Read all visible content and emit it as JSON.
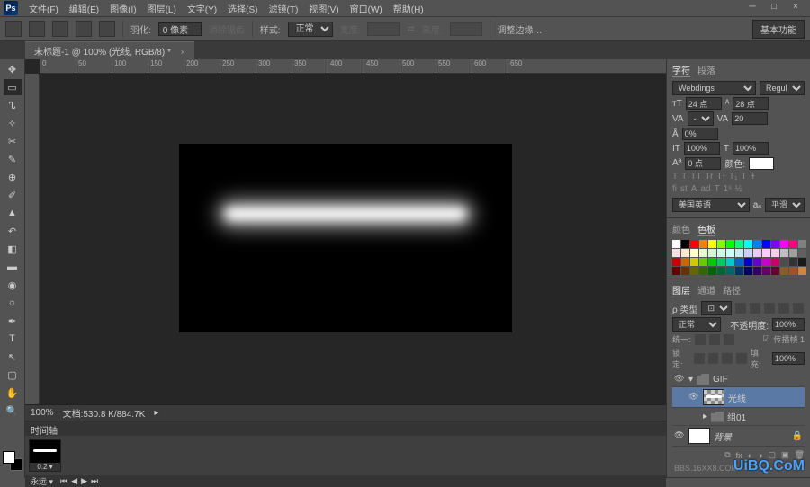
{
  "menu": {
    "items": [
      "文件(F)",
      "编辑(E)",
      "图像(I)",
      "图层(L)",
      "文字(Y)",
      "选择(S)",
      "滤镜(T)",
      "视图(V)",
      "窗口(W)",
      "帮助(H)"
    ]
  },
  "optbar": {
    "feather_label": "羽化:",
    "feather_value": "0 像素",
    "antialias": "消除锯齿",
    "style_label": "样式:",
    "style_value": "正常",
    "width_label": "宽度:",
    "height_label": "高度:",
    "refine": "调整边缘…",
    "workspace_pill": "基本功能"
  },
  "doctab": {
    "title": "未标题-1 @ 100% (光线, RGB/8) *"
  },
  "ruler_ticks": [
    "0",
    "50",
    "100",
    "150",
    "200",
    "250",
    "300",
    "350",
    "400",
    "450",
    "500",
    "550",
    "600",
    "650"
  ],
  "status": {
    "zoom": "100%",
    "docinfo": "文档:530.8 K/884.7K"
  },
  "timeline": {
    "title": "时间轴",
    "frame_delay": "0.2 ▾",
    "loop": "永远 ▾"
  },
  "char_panel": {
    "tabs": [
      "字符",
      "段落"
    ],
    "font": "Webdings",
    "font_style": "Regular",
    "size_label": "T",
    "size": "24 点",
    "leading_label": "A",
    "leading": "28 点",
    "tracking": "20",
    "kerning": "VA",
    "baseline": "0%",
    "vscale_label": "IT",
    "vscale": "100%",
    "hscale_label": "T",
    "hscale": "100%",
    "baseline_shift_label": "Aª",
    "baseline_shift": "0 点",
    "color_label": "颜色:",
    "styles": [
      "T",
      "T",
      "TT",
      "Tr",
      "T¹",
      "T₁",
      "T",
      "Ŧ"
    ],
    "fi": "fi",
    "st": "st",
    "aa_lang": "美国英语",
    "aa_label": "aₐ",
    "aa": "平滑"
  },
  "swatches_panel": {
    "tabs": [
      "颜色",
      "色板"
    ],
    "colors": [
      "#ffffff",
      "#000000",
      "#ff0000",
      "#ff8000",
      "#ffff00",
      "#80ff00",
      "#00ff00",
      "#00ff80",
      "#00ffff",
      "#0080ff",
      "#0000ff",
      "#8000ff",
      "#ff00ff",
      "#ff0080",
      "#808080",
      "#ffe0e0",
      "#ffe8cc",
      "#ffffcc",
      "#e8ffcc",
      "#ccffcc",
      "#ccffe8",
      "#ccffff",
      "#cce8ff",
      "#ccccff",
      "#e8ccff",
      "#ffccff",
      "#ffcce8",
      "#c0c0c0",
      "#a0a0a0",
      "#606060",
      "#cc0000",
      "#cc6600",
      "#cccc00",
      "#66cc00",
      "#00cc00",
      "#00cc66",
      "#00cccc",
      "#0066cc",
      "#0000cc",
      "#6600cc",
      "#cc00cc",
      "#cc0066",
      "#4d4d4d",
      "#333333",
      "#1a1a1a",
      "#660000",
      "#663300",
      "#666600",
      "#336600",
      "#006600",
      "#006633",
      "#006666",
      "#003366",
      "#000066",
      "#330066",
      "#660066",
      "#660033",
      "#8a5a2b",
      "#a0522d",
      "#cd853f"
    ]
  },
  "layers_panel": {
    "tabs": [
      "图层",
      "通道",
      "路径"
    ],
    "filter_label": "ρ 类型",
    "blend": "正常",
    "opacity_label": "不透明度:",
    "opacity": "100%",
    "lock_label": "锁定:",
    "fill_label": "填充:",
    "fill": "100%",
    "unify_label": "统一:",
    "propagate": "传播帧 1",
    "group1": "GIF",
    "layer_light": "光线",
    "group2": "组01",
    "layer_bg": "背景"
  },
  "watermark": "UiBQ.CoM",
  "watermark2": "BBS.16XX8.COM"
}
